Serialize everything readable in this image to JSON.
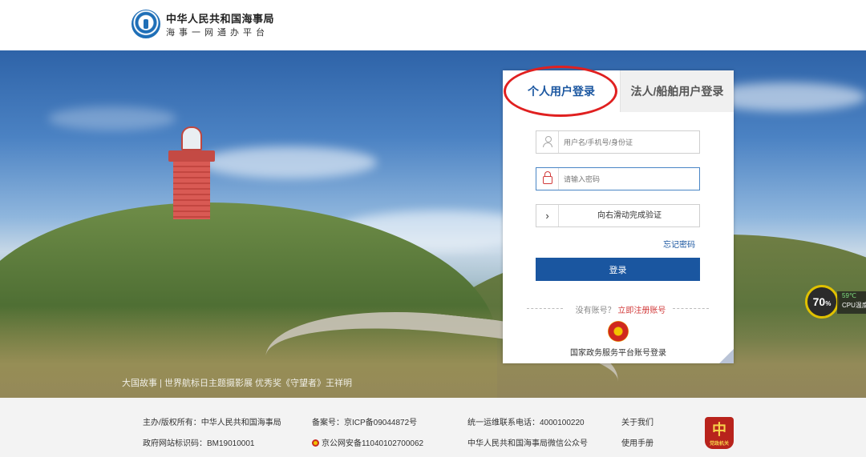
{
  "header": {
    "title": "中华人民共和国海事局",
    "subtitle": "海事一网通办平台"
  },
  "hero": {
    "photo_credit": "大国故事 | 世界航标日主题摄影展 优秀奖《守望者》王祥明"
  },
  "login": {
    "tabs": [
      {
        "label": "个人用户登录",
        "active": true
      },
      {
        "label": "法人/船舶用户登录",
        "active": false
      }
    ],
    "username_placeholder": "用户名/手机号/身份证",
    "password_placeholder": "请输入密码",
    "slider_text": "向右滑动完成验证",
    "slider_arrow": "›",
    "forgot_label": "忘记密码",
    "login_label": "登录",
    "no_account_text": "没有账号？",
    "register_label": "立即注册账号",
    "gov_login_label": "国家政务服务平台账号登录"
  },
  "cpu_widget": {
    "percent": "70",
    "percent_unit": "%",
    "temperature": "59℃",
    "label": "CPU温度"
  },
  "footer": {
    "col1": [
      "主办/版权所有：中华人民共和国海事局",
      "政府网站标识码：BM19010001"
    ],
    "col2": [
      "备案号：京ICP备09044872号",
      "京公网安备11040102700062"
    ],
    "col3": [
      "统一运维联系电话：4000100220",
      "中华人民共和国海事局微信公众号"
    ],
    "col4": [
      "关于我们",
      "使用手册"
    ],
    "badge_char": "中",
    "badge_text": "党政机关"
  },
  "colors": {
    "brand_blue": "#1a56a0",
    "accent_red": "#d23b3b",
    "highlight_ring": "#e02020"
  },
  "icons": {
    "emblem": "msa-emblem-icon",
    "user": "user-icon",
    "lock": "lock-icon",
    "slider": "chevron-right-icon",
    "gov": "national-emblem-icon",
    "police": "police-badge-icon"
  }
}
